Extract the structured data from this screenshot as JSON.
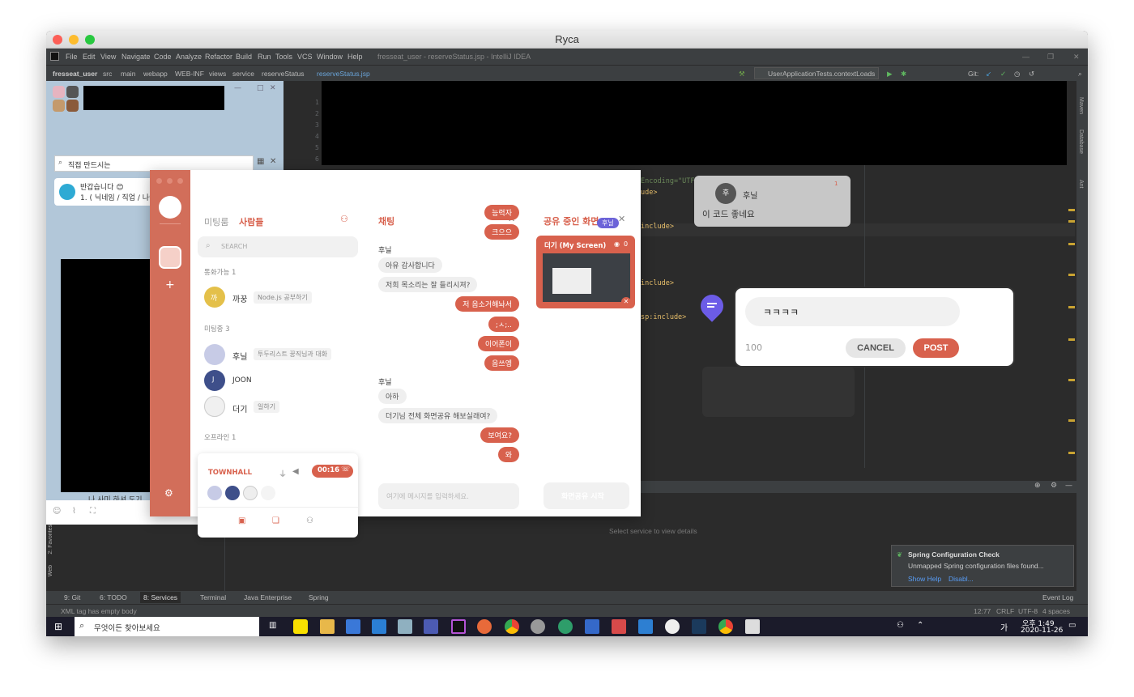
{
  "window": {
    "title": "Ryca"
  },
  "ide": {
    "app_title": "fresseat_user - reserveStatus.jsp - IntelliJ IDEA",
    "menu": [
      "File",
      "Edit",
      "View",
      "Navigate",
      "Code",
      "Analyze",
      "Refactor",
      "Build",
      "Run",
      "Tools",
      "VCS",
      "Window",
      "Help"
    ],
    "breadcrumbs": [
      "fresseat_user",
      "src",
      "main",
      "webapp",
      "WEB-INF",
      "views",
      "service",
      "reserveStatus",
      "reserveStatus.jsp"
    ],
    "run_config": "UserApplicationTests.contextLoads",
    "git_label": "Git:",
    "line_numbers": [
      "1",
      "2",
      "3",
      "4",
      "5",
      "6"
    ],
    "code_fragments": {
      "encoding": "Encoding=\"UTF-8\"%>",
      "ude": "ude>",
      "include1": "include>",
      "include2": "include>",
      "jsp_include": "sp:include>"
    },
    "services_hint": "Select service to view details",
    "right_tools": [
      "Maven",
      "Database",
      "Ant"
    ],
    "left_tools": [
      "2: Favorites",
      "Web"
    ],
    "bottom_tabs": [
      "9: Git",
      "6: TODO",
      "8: Services",
      "Terminal",
      "Java Enterprise",
      "Spring"
    ],
    "event_log": "Event Log",
    "status_left": "XML tag has empty body",
    "status_right": {
      "position": "12:77",
      "line_sep": "CRLF",
      "encoding": "UTF-8",
      "indent": "4 spaces"
    },
    "notification": {
      "title": "Spring Configuration Check",
      "body": "Unmapped Spring configuration files found...",
      "action1": "Show Help",
      "action2": "Disabl..."
    }
  },
  "kakao_chat": {
    "search_text": "직접 만드시는",
    "notice_line1": "반갑습니다 😊",
    "notice_line2": "1. ( 닉네임 / 직업 / 나이 ) 로 닉네임 변경해주세요.",
    "bottom_text": "나 사미 하셔 도기"
  },
  "meeting": {
    "tabs": {
      "meeting": "미팅룸",
      "people": "사람들"
    },
    "search_placeholder": "SEARCH",
    "sections": {
      "available": "통화가능 1",
      "in_meeting": "미팅중 3",
      "offline": "오프라인 1"
    },
    "available_people": [
      {
        "initial": "까",
        "name": "까꿍",
        "status": "Node.js 공부하기"
      }
    ],
    "meeting_people": [
      {
        "name": "후닐",
        "status": "투두리스트 꿍직님과 대화"
      },
      {
        "initial": "J",
        "name": "JOON",
        "status": ""
      },
      {
        "name": "더기",
        "status": "일하기"
      }
    ],
    "townhall": {
      "label": "TOWNHALL",
      "timer": "00:16"
    },
    "chat": {
      "title": "채팅",
      "messages": [
        {
          "from": "me",
          "text": "능력자"
        },
        {
          "from": "me",
          "text": "크으으"
        },
        {
          "from": "sender",
          "text": "후닐"
        },
        {
          "from": "other",
          "text": "아유 감사합니다"
        },
        {
          "from": "other",
          "text": "저희 목소리는 잘 들리시져?"
        },
        {
          "from": "me",
          "text": "저 음소거해놔서"
        },
        {
          "from": "me",
          "text": ";ㅅ;.."
        },
        {
          "from": "me",
          "text": "이어폰이"
        },
        {
          "from": "me",
          "text": "음쓰엥"
        },
        {
          "from": "sender",
          "text": "후닐"
        },
        {
          "from": "other",
          "text": "아하"
        },
        {
          "from": "other",
          "text": "더기님 전체 화면공유 해보실래여?"
        },
        {
          "from": "me",
          "text": "보여요?"
        },
        {
          "from": "me",
          "text": "와"
        }
      ],
      "input_placeholder": "여기에 메시지를 입력하세요."
    },
    "sharing": {
      "title": "공유 중인 화면",
      "cursor_tag": "후닐",
      "screen_label": "더기 (My Screen)",
      "viewer_count": "0",
      "start_button": "화면공유 시작"
    }
  },
  "comment_popup": {
    "author_initial": "후",
    "author": "후닐",
    "comment": "이 코드 좋네요",
    "badge": "1",
    "input_value": "ㅋㅋㅋㅋ",
    "char_count": "100",
    "cancel_label": "CANCEL",
    "post_label": "POST"
  },
  "taskbar": {
    "search_placeholder": "무엇이든 찾아보세요",
    "time": "오후 1:49",
    "date": "2020-11-26",
    "ime": "가"
  },
  "colors": {
    "accent": "#d8614d",
    "sidebar": "#d26e5a",
    "ide_bg": "#2b2b2b",
    "pin": "#6c5ce7"
  }
}
